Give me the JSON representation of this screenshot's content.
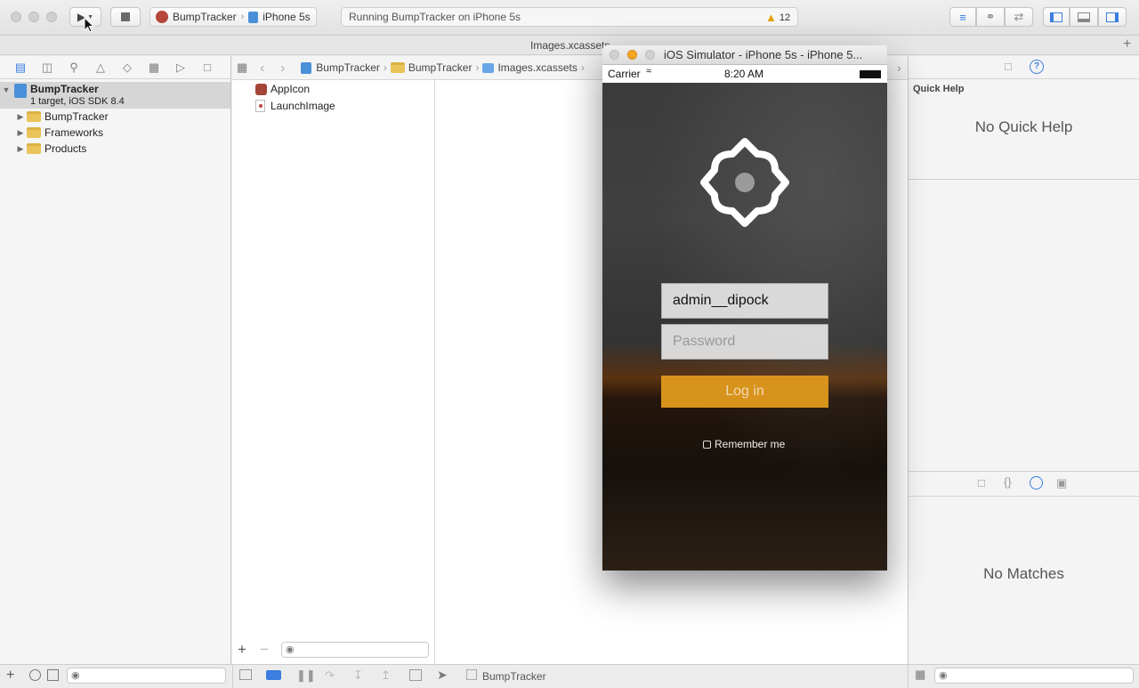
{
  "toolbar": {
    "scheme_target": "BumpTracker",
    "scheme_device": "iPhone 5s",
    "activity_text": "Running BumpTracker on iPhone 5s",
    "warning_count": "12"
  },
  "tab": {
    "title": "Images.xcassets"
  },
  "navigator": {
    "project_name": "BumpTracker",
    "project_subtitle": "1 target, iOS SDK 8.4",
    "groups": [
      "BumpTracker",
      "Frameworks",
      "Products"
    ]
  },
  "jumpbar": {
    "crumbs": [
      "BumpTracker",
      "BumpTracker",
      "Images.xcassets"
    ]
  },
  "assets": {
    "items": [
      "AppIcon",
      "LaunchImage"
    ]
  },
  "utilities": {
    "quick_help_header": "Quick Help",
    "quick_help_empty": "No Quick Help",
    "library_empty": "No Matches"
  },
  "bottombar": {
    "scheme_name": "BumpTracker"
  },
  "simulator": {
    "window_title": "iOS Simulator - iPhone 5s - iPhone 5...",
    "carrier": "Carrier",
    "time": "8:20 AM",
    "username_value": "admin__dipock",
    "password_placeholder": "Password",
    "login_label": "Log in",
    "remember_label": "Remember me",
    "accent_color": "#d8931c"
  }
}
